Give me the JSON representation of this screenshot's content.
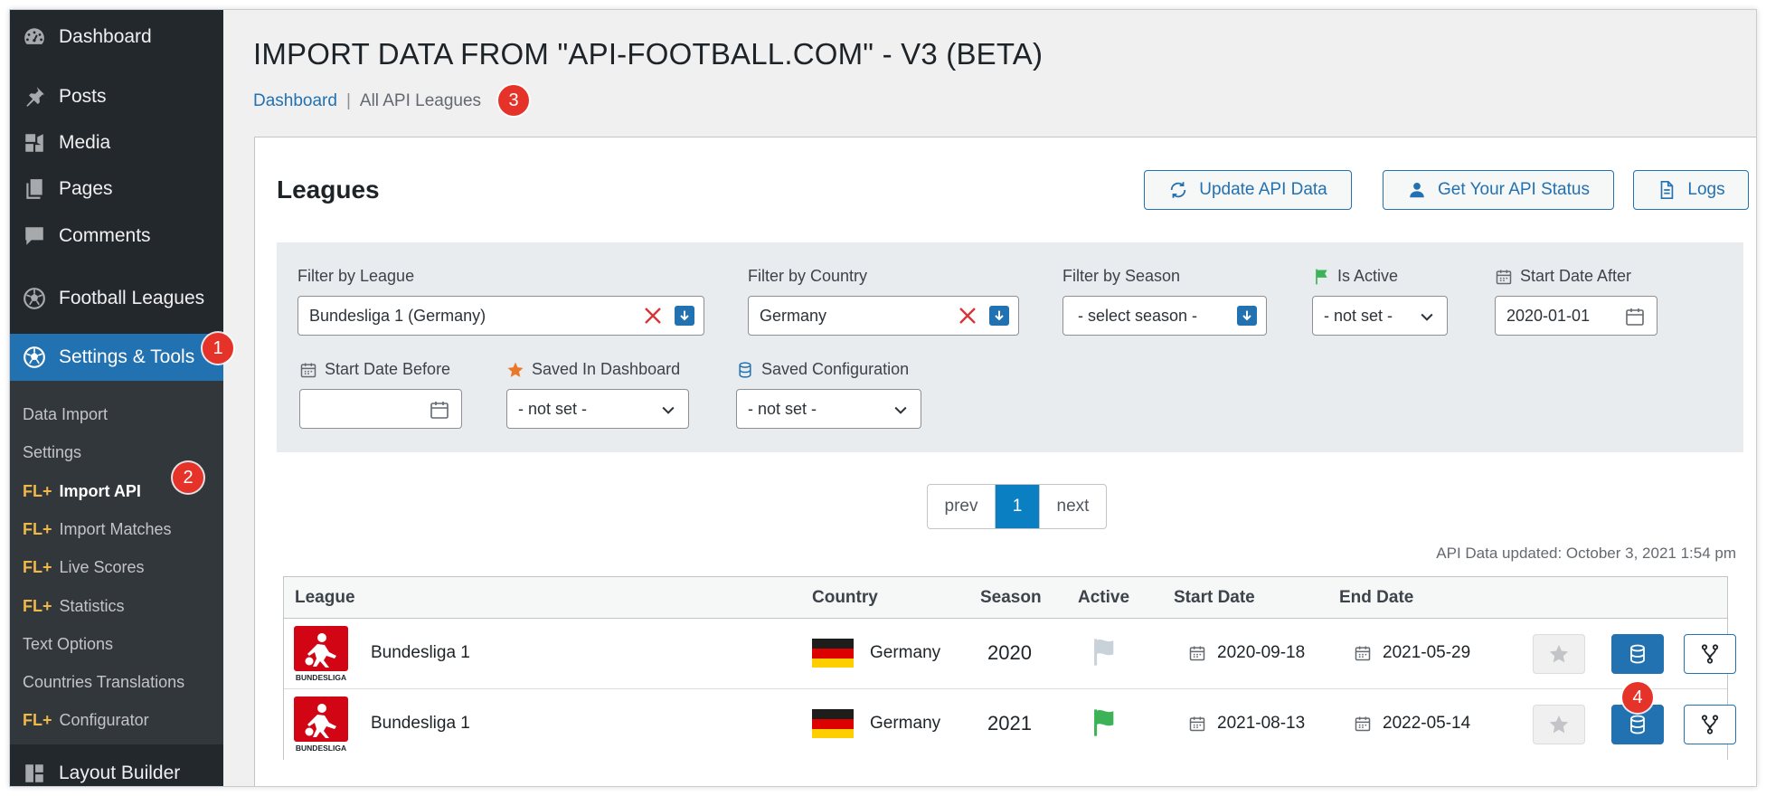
{
  "sidebar": {
    "menu": {
      "dashboard": "Dashboard",
      "posts": "Posts",
      "media": "Media",
      "pages": "Pages",
      "comments": "Comments",
      "football_leagues": "Football Leagues",
      "settings_tools": "Settings & Tools",
      "layout_builder": "Layout Builder"
    },
    "submenu": {
      "data_import": "Data Import",
      "settings": "Settings",
      "fl_prefix": "FL+",
      "import_api": "Import API",
      "import_matches": "Import Matches",
      "live_scores": "Live Scores",
      "statistics": "Statistics",
      "text_options": "Text Options",
      "countries_translations": "Countries Translations",
      "configurator": "Configurator"
    }
  },
  "badges": [
    "1",
    "2",
    "3",
    "4"
  ],
  "header": {
    "title": "IMPORT DATA FROM \"API-FOOTBALL.COM\" - V3 (BETA)",
    "breadcrumb_home": "Dashboard",
    "breadcrumb_sep": "|",
    "breadcrumb_current": "All API Leagues"
  },
  "panel": {
    "title": "Leagues",
    "buttons": {
      "update": "Update API Data",
      "status": "Get Your API Status",
      "logs": "Logs"
    }
  },
  "filters": {
    "league": {
      "label": "Filter by League",
      "value": "Bundesliga 1 (Germany)"
    },
    "country": {
      "label": "Filter by Country",
      "value": "Germany"
    },
    "season": {
      "label": "Filter by Season",
      "value": "- select season -"
    },
    "is_active": {
      "label": "Is Active",
      "value": "- not set -"
    },
    "start_after": {
      "label": "Start Date After",
      "value": "2020-01-01"
    },
    "start_before": {
      "label": "Start Date Before",
      "value": ""
    },
    "saved_dashboard": {
      "label": "Saved In Dashboard",
      "value": "- not set -"
    },
    "saved_config": {
      "label": "Saved Configuration",
      "value": "- not set -"
    }
  },
  "pagination": {
    "prev": "prev",
    "current": "1",
    "next": "next"
  },
  "api_updated": "API Data updated: October 3, 2021 1:54 pm",
  "table": {
    "headers": {
      "league": "League",
      "country": "Country",
      "season": "Season",
      "active": "Active",
      "start": "Start Date",
      "end": "End Date"
    },
    "logo_text": "BUNDESLIGA",
    "rows": [
      {
        "league": "Bundesliga 1",
        "country": "Germany",
        "season": "2020",
        "active": false,
        "start": "2020-09-18",
        "end": "2021-05-29"
      },
      {
        "league": "Bundesliga 1",
        "country": "Germany",
        "season": "2021",
        "active": true,
        "start": "2021-08-13",
        "end": "2022-05-14"
      }
    ]
  },
  "colors": {
    "sidebar_bg": "#23282d",
    "submenu_bg": "#32373c",
    "accent": "#2271b1",
    "fl_prefix": "#f0b849",
    "badge": "#e5332a",
    "flag_active": "#3cb356",
    "flag_inactive": "#c9d1d9"
  },
  "icons": {
    "dashboard": "dashboard-icon",
    "posts": "pin-icon",
    "media": "media-icon",
    "pages": "pages-icon",
    "comments": "comment-icon",
    "football": "football-icon",
    "layout": "layout-icon",
    "update": "refresh-icon",
    "status": "user-icon",
    "logs": "document-icon",
    "flag": "flag-icon",
    "calendar": "calendar-icon",
    "star": "star-icon",
    "database": "database-icon",
    "fork": "fork-icon"
  }
}
